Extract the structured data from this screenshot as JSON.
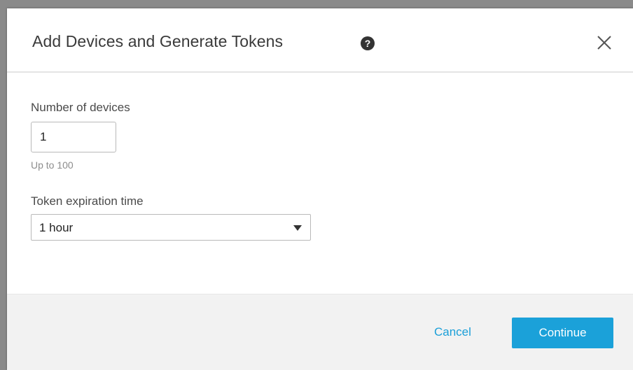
{
  "dialog": {
    "title": "Add Devices and Generate Tokens",
    "help_icon": "question-circle-icon",
    "close_icon": "close-icon"
  },
  "form": {
    "num_devices": {
      "label": "Number of devices",
      "value": "1",
      "hint": "Up to 100"
    },
    "expiration": {
      "label": "Token expiration time",
      "selected": "1 hour"
    }
  },
  "footer": {
    "cancel_label": "Cancel",
    "continue_label": "Continue"
  },
  "colors": {
    "accent": "#1ba1d9",
    "link": "#1b9fd8",
    "footer_bg": "#f2f2f2"
  }
}
